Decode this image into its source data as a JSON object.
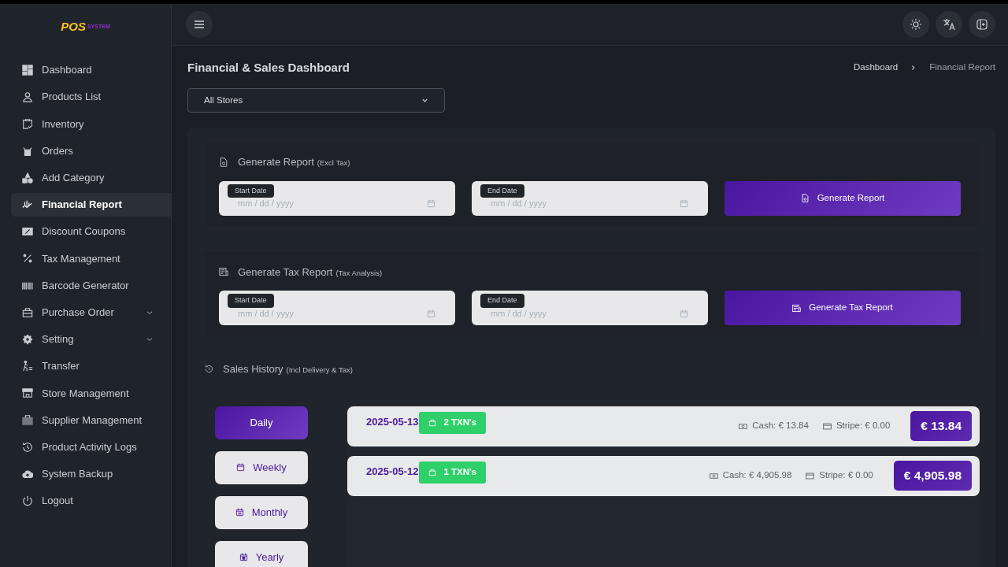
{
  "logo": {
    "main": "POS",
    "sub": "SYSTEM"
  },
  "sidebar": {
    "items": [
      {
        "label": "Dashboard",
        "kind": "link",
        "selected": false
      },
      {
        "label": "Products List",
        "kind": "link",
        "selected": false
      },
      {
        "label": "Inventory",
        "kind": "link",
        "selected": false
      },
      {
        "label": "Orders",
        "kind": "link",
        "selected": false
      },
      {
        "label": "Add Category",
        "kind": "link",
        "selected": false
      },
      {
        "label": "Financial Report",
        "kind": "link",
        "selected": true
      },
      {
        "label": "Discount Coupons",
        "kind": "link",
        "selected": false
      },
      {
        "label": "Tax Management",
        "kind": "link",
        "selected": false
      },
      {
        "label": "Barcode Generator",
        "kind": "link",
        "selected": false
      },
      {
        "label": "Purchase Order",
        "kind": "group",
        "selected": false
      },
      {
        "label": "Setting",
        "kind": "group",
        "selected": false
      },
      {
        "label": "Transfer",
        "kind": "link",
        "selected": false
      },
      {
        "label": "Store Management",
        "kind": "link",
        "selected": false
      },
      {
        "label": "Supplier Management",
        "kind": "link",
        "selected": false
      },
      {
        "label": "Product Activity Logs",
        "kind": "link",
        "selected": false
      },
      {
        "label": "System Backup",
        "kind": "link",
        "selected": false
      },
      {
        "label": "Logout",
        "kind": "link",
        "selected": false
      }
    ]
  },
  "page": {
    "title": "Financial & Sales Dashboard",
    "breadcrumb": [
      "Dashboard",
      "Financial Report"
    ],
    "store_select": "All Stores"
  },
  "report_sections": [
    {
      "title": "Generate Report",
      "note": "(Excl Tax)",
      "start_label": "Start Date",
      "start_placeholder": "mm / dd / yyyy",
      "end_label": "End Date",
      "end_placeholder": "mm / dd / yyyy",
      "button": "Generate Report"
    },
    {
      "title": "Generate Tax Report",
      "note": "(Tax Analysis)",
      "start_label": "Start Date",
      "start_placeholder": "mm / dd / yyyy",
      "end_label": "End Date",
      "end_placeholder": "mm / dd / yyyy",
      "button": "Generate Tax Report"
    }
  ],
  "sales_history": {
    "title": "Sales History",
    "note": "(Incl Delivery & Tax)",
    "periods": [
      {
        "label": "Daily",
        "selected": true
      },
      {
        "label": "Weekly",
        "selected": false
      },
      {
        "label": "Monthly",
        "selected": false
      },
      {
        "label": "Yearly",
        "selected": false
      }
    ],
    "entries": [
      {
        "date": "2025-05-13",
        "txns": "2 TXN's",
        "cash": "Cash: € 13.84",
        "stripe": "Stripe: € 0.00",
        "total": "€ 13.84"
      },
      {
        "date": "2025-05-12",
        "txns": "1 TXN's",
        "cash": "Cash: € 4,905.98",
        "stripe": "Stripe: € 0.00",
        "total": "€ 4,905.98"
      }
    ]
  }
}
